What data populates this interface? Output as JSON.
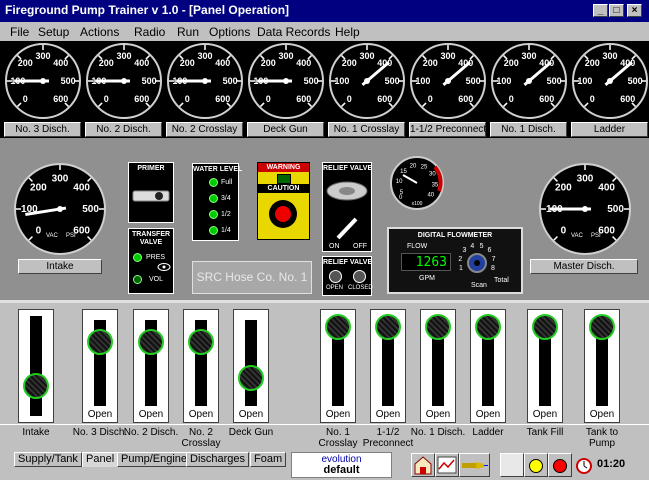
{
  "window": {
    "title": "Fireground Pump Trainer    v 1.0 - [Panel Operation]",
    "minimize": "_",
    "maximize": "□",
    "close": "×"
  },
  "menu": [
    {
      "label": "File"
    },
    {
      "label": "Setup"
    },
    {
      "label": "Actions"
    },
    {
      "label": "Radio"
    },
    {
      "label": "Run"
    },
    {
      "label": "Options"
    },
    {
      "label": "Data Records"
    },
    {
      "label": "Help"
    }
  ],
  "gauges": {
    "ticks": [
      "0",
      "100",
      "200",
      "300",
      "400",
      "500",
      "600"
    ],
    "labels": [
      "No. 3 Disch.",
      "No. 2 Disch.",
      "No. 2 Crosslay",
      "Deck Gun",
      "No. 1 Crosslay",
      "1-1/2 Preconnect",
      "No. 1 Disch.",
      "Ladder"
    ],
    "values_psi": [
      100,
      100,
      100,
      100,
      410,
      410,
      410,
      410
    ]
  },
  "intake_gauge": {
    "label": "Intake",
    "vac": "VAC",
    "psi": "PSI",
    "value_psi": 80
  },
  "master_gauge": {
    "label": "Master Disch.",
    "vac": "VAC",
    "psi": "PSI",
    "value_psi": 100
  },
  "primer": {
    "title": "PRIMER"
  },
  "transfer_valve": {
    "title1": "TRANSFER",
    "title2": "VALVE",
    "pres": "PRES",
    "vol": "VOL"
  },
  "water_level": {
    "title": "WATER LEVEL",
    "levels": [
      "Full",
      "3/4",
      "1/2",
      "1/4"
    ]
  },
  "warning": {
    "title": "WARNING",
    "caution": "CAUTION"
  },
  "relief_valve_top": {
    "title": "RELIEF VALVE",
    "on": "ON",
    "off": "OFF"
  },
  "relief_valve_bottom": {
    "title": "RELIEF VALVE",
    "open": "OPEN",
    "closed": "CLOSED"
  },
  "tach": {
    "ticks": [
      "5",
      "10",
      "15",
      "20",
      "25",
      "30",
      "35",
      "40"
    ],
    "unit": "x100",
    "zero": "0"
  },
  "flowmeter": {
    "title": "DIGITAL FLOWMETER",
    "flow_label": "FLOW",
    "flow_value": "1263",
    "unit": "GPM",
    "dial_numbers": [
      "1",
      "2",
      "3",
      "4",
      "5",
      "6",
      "7",
      "8"
    ],
    "scan": "Scan",
    "total": "Total"
  },
  "company_label": "SRC Hose Co. No. 1",
  "valves": [
    {
      "label": "Intake",
      "label2": "",
      "open_text": "",
      "knob_pos": 0.85
    },
    {
      "label": "No. 3 Disch.",
      "label2": "",
      "open_text": "Open",
      "knob_pos": 0.25
    },
    {
      "label": "No. 2 Disch.",
      "label2": "",
      "open_text": "Open",
      "knob_pos": 0.25
    },
    {
      "label": "No. 2",
      "label2": "Crosslay",
      "open_text": "Open",
      "knob_pos": 0.25
    },
    {
      "label": "Deck Gun",
      "label2": "",
      "open_text": "Open",
      "knob_pos": 0.85
    },
    {
      "label": "No. 1",
      "label2": "Crosslay",
      "open_text": "Open",
      "knob_pos": 0.0
    },
    {
      "label": "1-1/2",
      "label2": "Preconnect",
      "open_text": "Open",
      "knob_pos": 0.0
    },
    {
      "label": "No. 1 Disch.",
      "label2": "",
      "open_text": "Open",
      "knob_pos": 0.0
    },
    {
      "label": "Ladder",
      "label2": "",
      "open_text": "Open",
      "knob_pos": 0.0
    },
    {
      "label": "Tank Fill",
      "label2": "",
      "open_text": "Open",
      "knob_pos": 0.0
    },
    {
      "label": "Tank to",
      "label2": "Pump",
      "open_text": "Open",
      "knob_pos": 0.0
    }
  ],
  "tabs": [
    {
      "label": "Supply/Tank",
      "active": false
    },
    {
      "label": "Panel",
      "active": true
    },
    {
      "label": "Pump/Engine",
      "active": false
    },
    {
      "label": "Discharges",
      "active": false
    },
    {
      "label": "Foam",
      "active": false
    }
  ],
  "status": {
    "line1": "evolution",
    "line2": "default"
  },
  "clock": "01:20"
}
